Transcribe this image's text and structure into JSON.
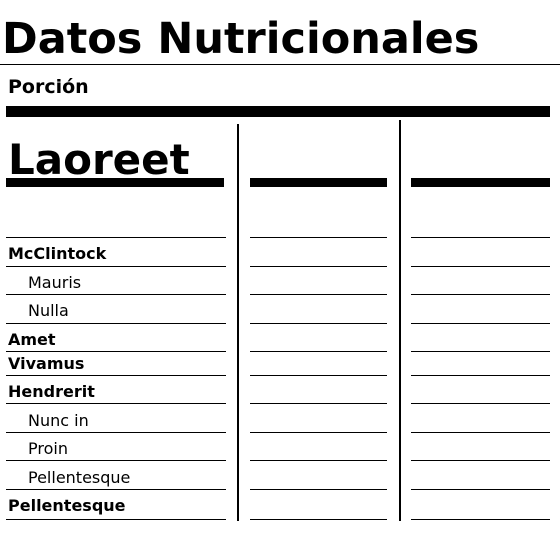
{
  "label": {
    "title": "Datos Nutricionales",
    "serving_label": "Porción",
    "header": {
      "main": "Laoreet",
      "col2": "",
      "col3": ""
    },
    "rows": [
      {
        "name": "McClintock",
        "bold": true,
        "indent": false,
        "col2": "",
        "col3": ""
      },
      {
        "name": "Mauris",
        "bold": false,
        "indent": true,
        "col2": "",
        "col3": ""
      },
      {
        "name": "Nulla",
        "bold": false,
        "indent": true,
        "col2": "",
        "col3": ""
      },
      {
        "name": "Amet",
        "bold": true,
        "indent": false,
        "col2": "",
        "col3": ""
      },
      {
        "name": "Vivamus",
        "bold": true,
        "indent": false,
        "col2": "",
        "col3": ""
      },
      {
        "name": "Hendrerit",
        "bold": true,
        "indent": false,
        "col2": "",
        "col3": ""
      },
      {
        "name": "Nunc in",
        "bold": false,
        "indent": true,
        "col2": "",
        "col3": ""
      },
      {
        "name": "Proin",
        "bold": false,
        "indent": true,
        "col2": "",
        "col3": ""
      },
      {
        "name": "Pellentesque",
        "bold": false,
        "indent": true,
        "col2": "",
        "col3": ""
      },
      {
        "name": "Pellentesque",
        "bold": true,
        "indent": false,
        "col2": "",
        "col3": ""
      }
    ]
  }
}
